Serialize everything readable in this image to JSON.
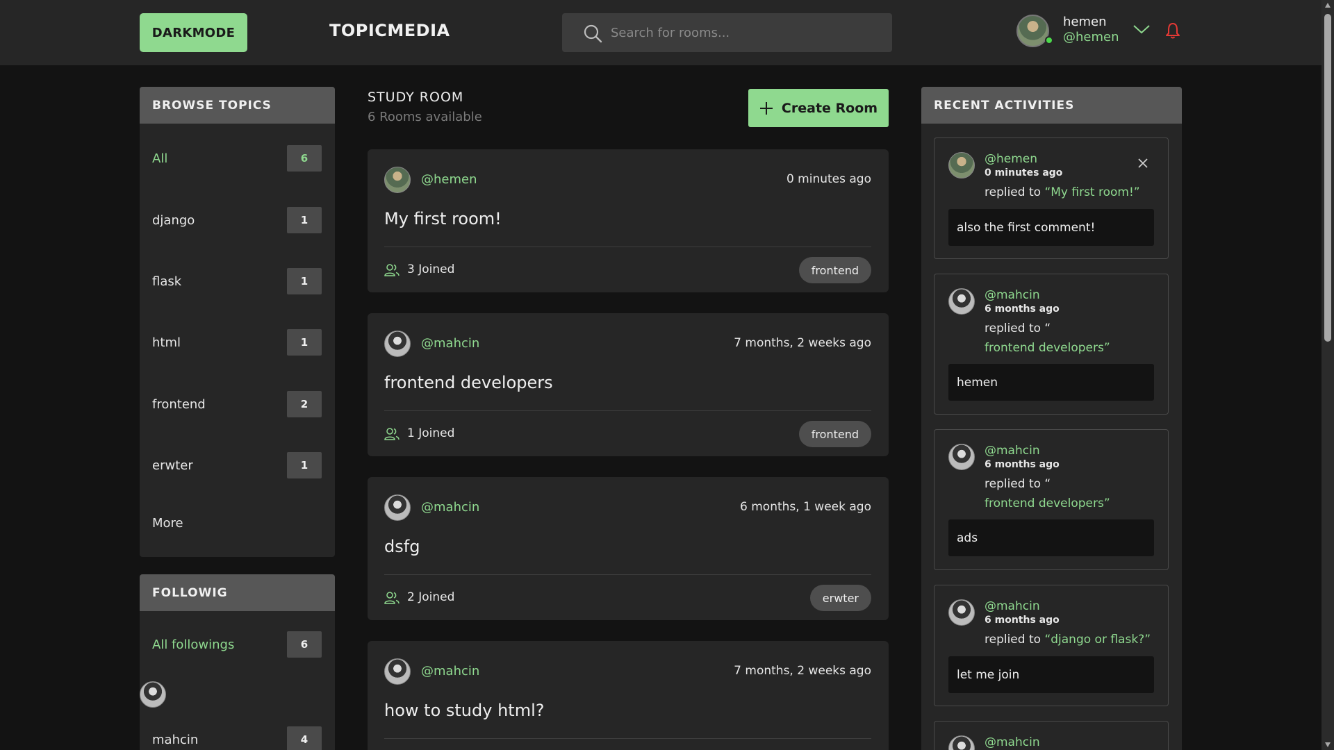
{
  "header": {
    "darkmode_label": "DARKMODE",
    "brand": "TOPICMEDIA",
    "search_placeholder": "Search for rooms...",
    "user_name": "hemen",
    "user_handle": "@hemen"
  },
  "topics": {
    "title": "BROWSE TOPICS",
    "items": [
      {
        "name": "All",
        "count": "6"
      },
      {
        "name": "django",
        "count": "1"
      },
      {
        "name": "flask",
        "count": "1"
      },
      {
        "name": "html",
        "count": "1"
      },
      {
        "name": "frontend",
        "count": "2"
      },
      {
        "name": "erwter",
        "count": "1"
      }
    ],
    "more_label": "More"
  },
  "following": {
    "title": "FOLLOWIG",
    "all_label": "All followings",
    "all_count": "6",
    "user": "mahcin",
    "user_count": "4"
  },
  "feed": {
    "title": "STUDY ROOM",
    "subtitle": "6 Rooms available",
    "create_label": "Create Room",
    "rooms": [
      {
        "host": "@hemen",
        "time": "0 minutes ago",
        "name": "My first room!",
        "joined": "3 Joined",
        "topic": "frontend"
      },
      {
        "host": "@mahcin",
        "time": "7 months, 2 weeks ago",
        "name": "frontend developers",
        "joined": "1 Joined",
        "topic": "frontend"
      },
      {
        "host": "@mahcin",
        "time": "6 months, 1 week ago",
        "name": "dsfg",
        "joined": "2 Joined",
        "topic": "erwter"
      },
      {
        "host": "@mahcin",
        "time": "7 months, 2 weeks ago",
        "name": "how to study html?"
      }
    ]
  },
  "activities": {
    "title": "RECENT ACTIVITIES",
    "items": [
      {
        "user": "@hemen",
        "time": "0 minutes ago",
        "reply_prefix": "replied to ",
        "room": "“My first room!”",
        "message": "also the first comment!"
      },
      {
        "user": "@mahcin",
        "time": "6 months ago",
        "reply_prefix": "replied to “",
        "room": "frontend developers”",
        "message": "hemen"
      },
      {
        "user": "@mahcin",
        "time": "6 months ago",
        "reply_prefix": "replied to “",
        "room": "frontend developers”",
        "message": "ads"
      },
      {
        "user": "@mahcin",
        "time": "6 months ago",
        "reply_prefix": "replied to ",
        "room": "“django or flask?”",
        "message": "let me join"
      },
      {
        "user": "@mahcin"
      }
    ]
  },
  "colors": {
    "accent": "#8fd98f",
    "background": "#131313",
    "panel": "#262626",
    "panel_header": "#575757",
    "notification": "#e53935"
  },
  "icons": {
    "search": "search-icon",
    "chevron": "chevron-down-icon",
    "bell": "bell-icon",
    "plus": "plus-icon",
    "people": "people-icon",
    "close": "close-icon"
  }
}
